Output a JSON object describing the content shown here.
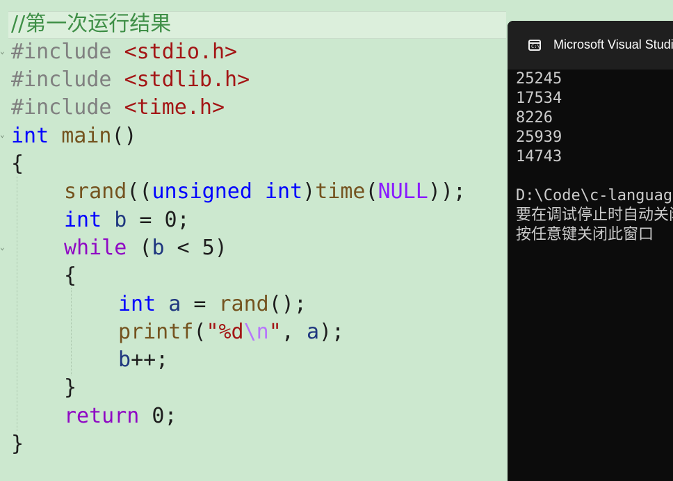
{
  "editor": {
    "comment": "//第一次运行结果",
    "includes": [
      {
        "directive": "#include",
        "header": "<stdio.h>"
      },
      {
        "directive": "#include",
        "header": "<stdlib.h>"
      },
      {
        "directive": "#include",
        "header": "<time.h>"
      }
    ],
    "tok": {
      "int": "int",
      "main": "main",
      "paren_empty": "()",
      "brace_open": "{",
      "brace_close": "}",
      "srand": "srand",
      "open_paren2": "((",
      "unsigned": "unsigned",
      "space": " ",
      "close_paren": ")",
      "time": "time",
      "open_paren": "(",
      "null": "NULL",
      "close_all": "));",
      "b": "b",
      "a": "a",
      "assign_space": " = ",
      "zero": "0",
      "semicolon": ";",
      "while": "while",
      "open_paren_sp": " (",
      "lt_five": " < 5)",
      "rand": "rand",
      "call_end": "();",
      "printf": "printf",
      "str_fmt": "\"%d",
      "str_esc": "\\n",
      "str_end": "\"",
      "comma_space": ", ",
      "call_close": ");",
      "incr": "++;",
      "return": "return",
      "return_val": " 0;"
    }
  },
  "console": {
    "title": "Microsoft Visual Studio Debug Console",
    "output": [
      "25245",
      "17534",
      "8226",
      "25939",
      "14743"
    ],
    "path_line": "D:\\Code\\c-language",
    "msg_line1": "要在调试停止时自动关闭控制台",
    "msg_line2": "按任意键关闭此窗口"
  }
}
